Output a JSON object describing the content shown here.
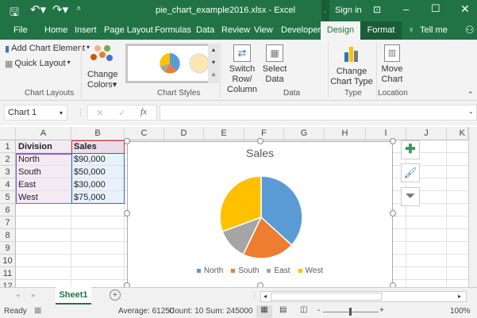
{
  "title_bar": {
    "title": "pie_chart_example2016.xlsx - Excel",
    "sign_in": "Sign in",
    "dot": "."
  },
  "tabs": [
    "File",
    "Home",
    "Insert",
    "Page Layout",
    "Formulas",
    "Data",
    "Review",
    "View",
    "Developer",
    "Design",
    "Format",
    "Tell me"
  ],
  "ribbon": {
    "add_chart_element": "Add Chart Element",
    "quick_layout": "Quick Layout",
    "change_colors_1": "Change",
    "change_colors_2": "Colors",
    "switch_1": "Switch Row/",
    "switch_2": "Column",
    "select_1": "Select",
    "select_2": "Data",
    "change_type_1": "Change",
    "change_type_2": "Chart Type",
    "move_1": "Move",
    "move_2": "Chart",
    "groups": [
      "Chart Layouts",
      "Chart Styles",
      "Data",
      "Type",
      "Location"
    ]
  },
  "formula_bar": {
    "name_box": "Chart 1",
    "fx": "fx",
    "value": ""
  },
  "columns": [
    "A",
    "B",
    "C",
    "D",
    "E",
    "F",
    "G",
    "H",
    "I",
    "J",
    "K"
  ],
  "rows": [
    "1",
    "2",
    "3",
    "4",
    "5",
    "6",
    "7",
    "8",
    "9",
    "10",
    "11",
    "12"
  ],
  "cells": [
    [
      "Division",
      "Sales"
    ],
    [
      "North",
      "$90,000"
    ],
    [
      "South",
      "$50,000"
    ],
    [
      "East",
      "$30,000"
    ],
    [
      "West",
      "$75,000"
    ]
  ],
  "chart_data": {
    "type": "pie",
    "title": "Sales",
    "categories": [
      "North",
      "South",
      "East",
      "West"
    ],
    "values": [
      90000,
      50000,
      30000,
      75000
    ],
    "colors": [
      "#5b9bd5",
      "#ed7d31",
      "#a5a5a5",
      "#ffc000"
    ],
    "legend": "bottom"
  },
  "sheet_tabs": [
    "Sheet1"
  ],
  "status": {
    "ready": "Ready",
    "average": "Average: 61250",
    "count": "Count: 10",
    "sum": "Sum: 245000",
    "zoom": "100%"
  }
}
